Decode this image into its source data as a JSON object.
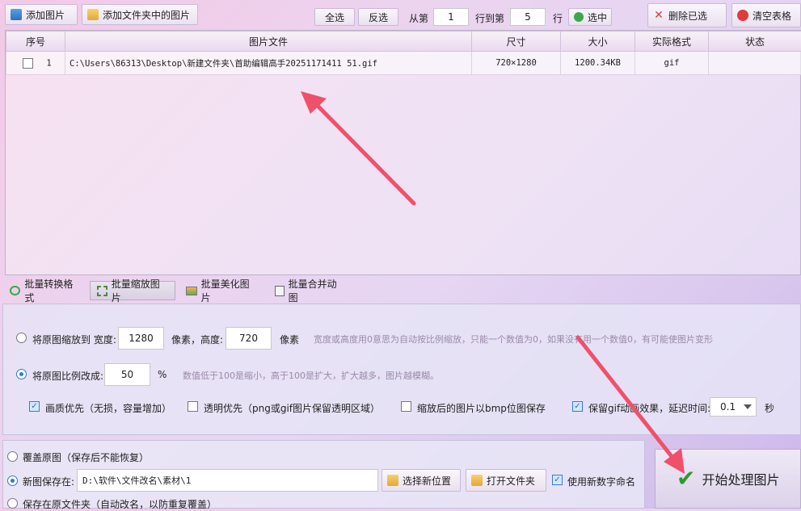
{
  "toolbar": {
    "add_image": "添加图片",
    "add_folder_images": "添加文件夹中的图片",
    "select_all": "全选",
    "invert": "反选",
    "from_label": "从第",
    "from_value": "1",
    "to_label": "行到第",
    "to_value": "5",
    "row_label": "行",
    "select": "选中",
    "delete_selected": "删除已选",
    "clear_table": "清空表格"
  },
  "table": {
    "headers": [
      "序号",
      "图片文件",
      "尺寸",
      "大小",
      "实际格式",
      "状态"
    ],
    "rows": [
      {
        "index": "1",
        "file": "C:\\Users\\86313\\Desktop\\新建文件夹\\首助编辑高手20251171411 51.gif",
        "dimensions": "720×1280",
        "size": "1200.34KB",
        "format": "gif",
        "status": ""
      }
    ]
  },
  "tabs": [
    "批量转换格式",
    "批量缩放图片",
    "批量美化图片",
    "批量合并动图"
  ],
  "scale": {
    "resize_label": "将原图缩放到 宽度:",
    "width": "1280",
    "height_label": "像素，高度:",
    "height": "720",
    "pixel_unit": "像素",
    "resize_hint": "宽度或高度用0意思为自动按比例缩放，只能一个数值为0，如果没有用一个数值0，有可能使图片变形",
    "ratio_label": "将原图比例改成:",
    "ratio": "50",
    "percent": "%",
    "ratio_hint": "数值低于100是缩小，高于100是扩大，扩大越多，图片越模糊。",
    "quality_first": "画质优先（无损，容量增加）",
    "transparent_first": "透明优先（png或gif图片保留透明区域）",
    "save_bmp": "缩放后的图片以bmp位图保存",
    "keep_gif_label": "保留gif动画效果，延迟时间:",
    "delay": "0.1",
    "seconds": "秒"
  },
  "output": {
    "overwrite": "覆盖原图（保存后不能恢复）",
    "save_new_label": "新图保存在:",
    "save_path": "D:\\软件\\文件改名\\素材\\1",
    "choose_location": "选择新位置",
    "open_folder": "打开文件夹",
    "use_new_number": "使用新数字命名",
    "save_original_folder": "保存在原文件夹（自动改名，以防重复覆盖）"
  },
  "start_button": "开始处理图片"
}
